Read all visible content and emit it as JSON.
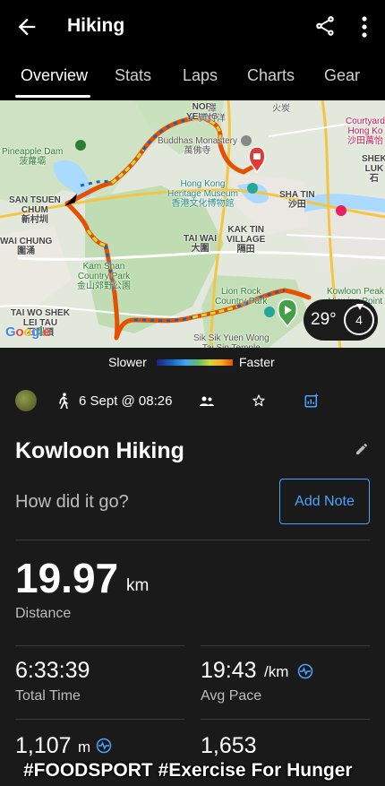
{
  "appbar": {
    "title": "Hiking"
  },
  "tabs": [
    "Overview",
    "Stats",
    "Laps",
    "Charts",
    "Gear"
  ],
  "map": {
    "labels": {
      "pineapple_dam": "Pineapple Dam\n菠蘿壩",
      "san_tsuen_chum": "SAN TSUEN\nCHUM\n新村圳",
      "wai_chung": "WAI CHUNG\n圍涌",
      "kam_shan": "Kam Shan\nCountry Park\n金山郊野公園",
      "tai_wo_shek": "TAI WO SHEK\nLEI TAU\n石梨頭",
      "nor_yeung": "NOR\nYEUNG",
      "buddhas_monastery": "Buddhas Monastery\n萬佛寺",
      "heritage_museum": "Hong Kong\nHeritage Museum\n香港文化博物館",
      "sha_tin": "SHA TIN\n沙田",
      "kak_tin": "KAK TIN\nVILLAGE\n隔田",
      "tai_wai": "TAI WAI\n大圍",
      "lion_rock": "Lion Rock\nCountry Park",
      "sik_sik_yuen": "Sik Sik Yuen Wong\nTai Sin Temple",
      "kowloon_peak": "Kowloon Peak\nViewing Point",
      "courtyard": "Courtyard\nHong Ko\n沙田萬怡",
      "shek": "SHEK\nLUK\n石",
      "tak_hang": "澤\n黃竹洋",
      "fo_tan": "火炭"
    },
    "weather": {
      "temperature": "29°",
      "wind": "4"
    }
  },
  "legend": {
    "slower": "Slower",
    "faster": "Faster"
  },
  "activity": {
    "date": "6 Sept @ 08:26",
    "title": "Kowloon Hiking",
    "prompt": "How did it go?",
    "add_note_label": "Add Note"
  },
  "stats": {
    "distance": {
      "value": "19.97",
      "unit": "km",
      "label": "Distance"
    },
    "total_time": {
      "value": "6:33:39",
      "label": "Total Time"
    },
    "avg_pace": {
      "value": "19:43",
      "unit": "/km",
      "label": "Avg Pace"
    },
    "elevation": {
      "value": "1,107",
      "unit": "m"
    },
    "calories": {
      "value": "1,653"
    }
  },
  "watermark": "#FOODSPORT #Exercise For Hunger"
}
